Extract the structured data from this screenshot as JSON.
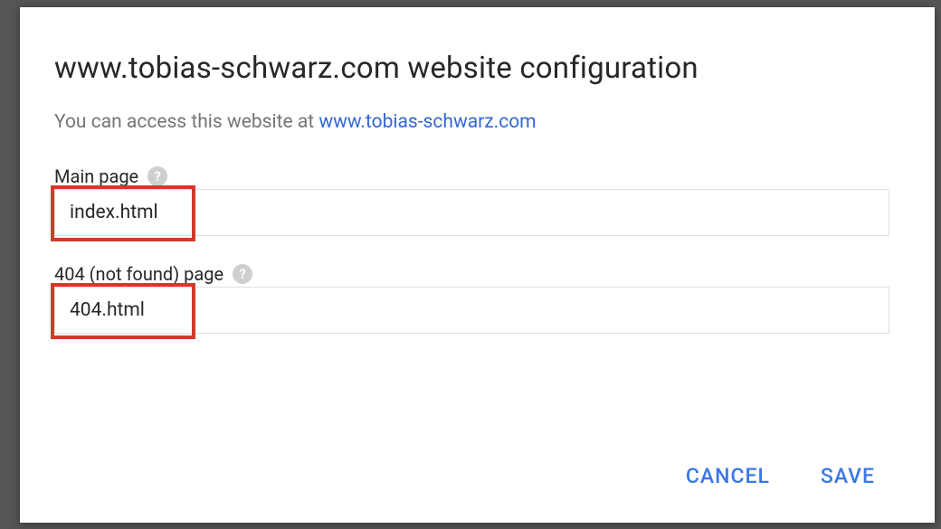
{
  "dialog": {
    "title": "www.tobias-schwarz.com website configuration",
    "subtitle_prefix": "You can access this website at ",
    "subtitle_link": "www.tobias-schwarz.com"
  },
  "fields": {
    "main_page": {
      "label": "Main page",
      "value": "index.html",
      "help": "?"
    },
    "not_found": {
      "label": "404 (not found) page",
      "value": "404.html",
      "help": "?"
    }
  },
  "actions": {
    "cancel": "CANCEL",
    "save": "SAVE"
  }
}
